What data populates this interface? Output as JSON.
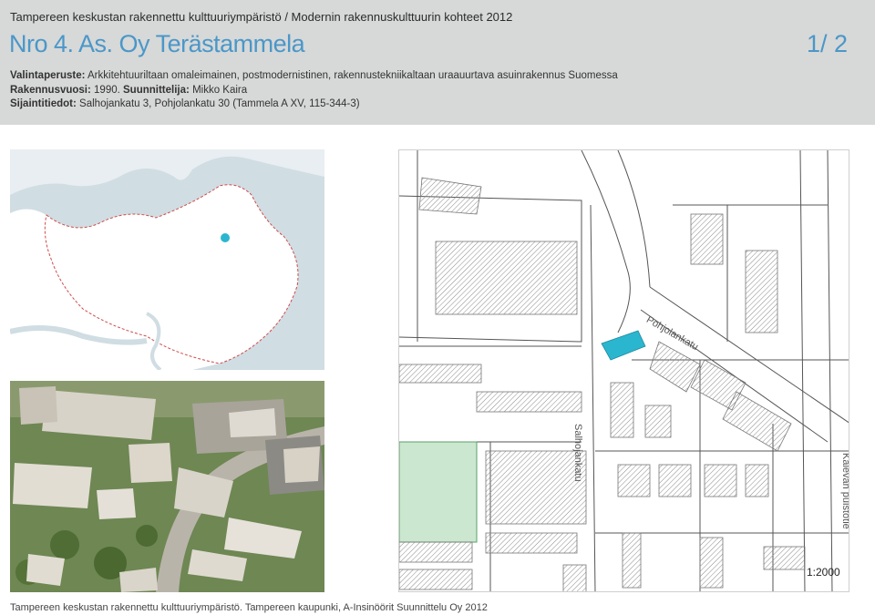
{
  "header": {
    "series": "Tampereen keskustan rakennettu kulttuuriympäristö /  Modernin rakennuskulttuurin kohteet 2012",
    "title": "Nro 4. As. Oy Terästammela",
    "page": "1/ 2"
  },
  "info": {
    "criteria_label": "Valintaperuste:",
    "criteria_value": "Arkkitehtuuriltaan omaleimainen, postmodernistinen, rakennustekniikaltaan uraauurtava asuinrakennus Suomessa",
    "year_label": "Rakennusvuosi:",
    "year_value": "1990.",
    "designer_label": "Suunnittelija:",
    "designer_value": "Mikko Kaira",
    "location_label": "Sijaintitiedot:",
    "location_value": "Salhojankatu 3, Pohjolankatu 30 (Tammela A XV,  115-344-3)"
  },
  "plan": {
    "streets": {
      "pohjolankatu": "Pohjolankatu",
      "salhojankatu": "Salhojankatu",
      "kalevan_puistotie": "Kalevan puistotie"
    },
    "scale": "1:2000",
    "colors": {
      "target": "#2bb6cf",
      "park": "#cbe7cf"
    }
  },
  "footer": "Tampereen keskustan rakennettu kulttuuriympäristö. Tampereen kaupunki, A-Insinöörit Suunnittelu Oy 2012"
}
